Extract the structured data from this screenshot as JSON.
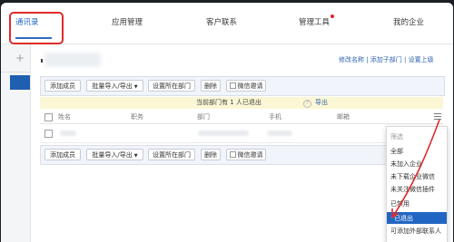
{
  "nav": {
    "tabs": [
      {
        "label": "通讯录"
      },
      {
        "label": "应用管理"
      },
      {
        "label": "客户联系"
      },
      {
        "label": "管理工具"
      },
      {
        "label": "我的企业"
      }
    ]
  },
  "sidebar": {
    "add_symbol": "+",
    "selected_item_icon": "⋮"
  },
  "header": {
    "links": "修改名称 | 添加子部门 | 设置上级"
  },
  "toolbar": {
    "add_member": "添加成员",
    "batch_import": "批量导入/导出",
    "set_department": "设置所在部门",
    "delete": "删除",
    "wechat_invite": "微信邀请"
  },
  "notice": {
    "text": "当前部门有 1 人已退出",
    "export": "导出"
  },
  "table": {
    "columns": [
      "姓名",
      "职务",
      "部门",
      "手机",
      "邮箱"
    ]
  },
  "filter_dropdown": {
    "title": "筛选",
    "options": [
      "全部",
      "未加入企业",
      "未下载企业微信",
      "未关注微信插件",
      "已禁用",
      "已退出",
      "可添加外部联系人"
    ],
    "selected": "已退出"
  },
  "colors": {
    "accent": "#2b6cc4",
    "annotation_red": "#e02b2b",
    "notice_bg": "#fbf7d4",
    "selected_bg": "#2266c4"
  }
}
